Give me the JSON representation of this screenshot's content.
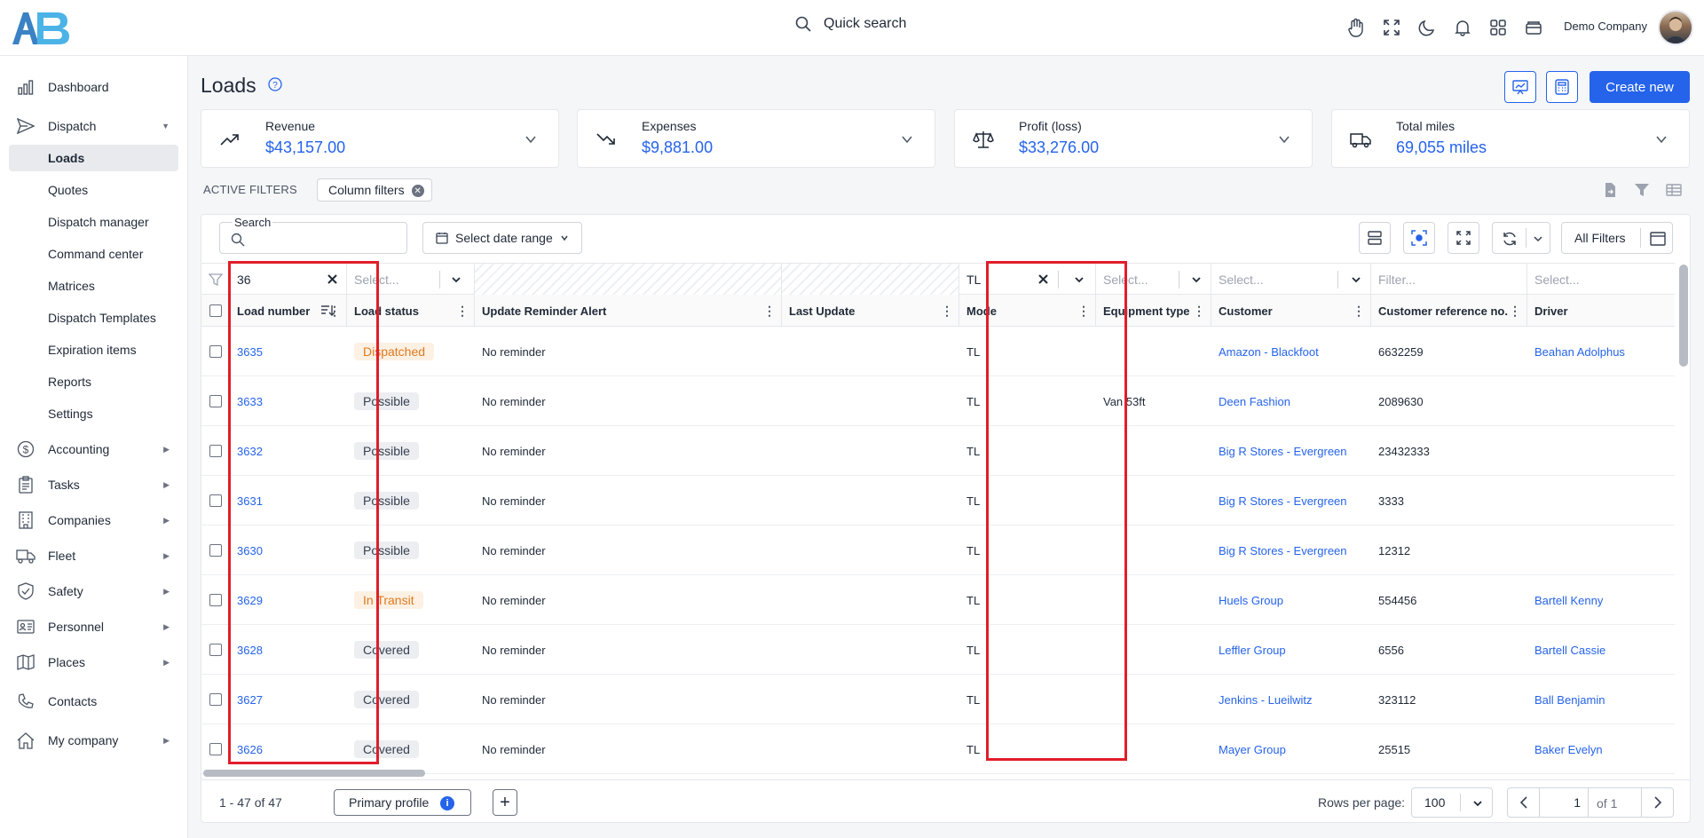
{
  "topbar": {
    "quick_search_label": "Quick search",
    "company_name": "Demo Company"
  },
  "sidebar": {
    "dashboard": "Dashboard",
    "dispatch": "Dispatch",
    "dispatch_items": [
      "Loads",
      "Quotes",
      "Dispatch manager",
      "Command center",
      "Matrices",
      "Dispatch Templates",
      "Expiration items",
      "Reports",
      "Settings"
    ],
    "accounting": "Accounting",
    "tasks": "Tasks",
    "companies": "Companies",
    "fleet": "Fleet",
    "safety": "Safety",
    "personnel": "Personnel",
    "places": "Places",
    "contacts": "Contacts",
    "my_company": "My company"
  },
  "page": {
    "title": "Loads",
    "create_label": "Create new"
  },
  "stats": [
    {
      "label": "Revenue",
      "value": "$43,157.00",
      "icon": "trend-up-icon"
    },
    {
      "label": "Expenses",
      "value": "$9,881.00",
      "icon": "trend-down-icon"
    },
    {
      "label": "Profit (loss)",
      "value": "$33,276.00",
      "icon": "scale-icon"
    },
    {
      "label": "Total miles",
      "value": "69,055 miles",
      "icon": "truck-icon"
    }
  ],
  "filters": {
    "active_label": "ACTIVE FILTERS",
    "chip_label": "Column filters"
  },
  "toolbar": {
    "search_label": "Search",
    "date_range_label": "Select date range",
    "all_filters_label": "All Filters"
  },
  "column_filters": {
    "load_number": "36",
    "load_status": "Select...",
    "mode": "TL",
    "equipment_type": "Select...",
    "customer": "Select...",
    "customer_ref": "Filter...",
    "driver": "Select..."
  },
  "columns": {
    "load_number": "Load number",
    "load_status": "Load status",
    "reminder": "Update Reminder Alert",
    "last_update": "Last Update",
    "mode": "Mode",
    "equipment_type": "Equipment type",
    "customer": "Customer",
    "customer_ref": "Customer reference no.",
    "driver": "Driver"
  },
  "rows": [
    {
      "load": "3635",
      "status": "Dispatched",
      "reminder": "No reminder",
      "mode": "TL",
      "equipment": "",
      "customer": "Amazon - Blackfoot",
      "ref": "6632259",
      "driver": "Beahan Adolphus"
    },
    {
      "load": "3633",
      "status": "Possible",
      "reminder": "No reminder",
      "mode": "TL",
      "equipment": "Van 53ft",
      "customer": "Deen Fashion",
      "ref": "2089630",
      "driver": ""
    },
    {
      "load": "3632",
      "status": "Possible",
      "reminder": "No reminder",
      "mode": "TL",
      "equipment": "",
      "customer": "Big R Stores - Evergreen",
      "ref": "23432333",
      "driver": ""
    },
    {
      "load": "3631",
      "status": "Possible",
      "reminder": "No reminder",
      "mode": "TL",
      "equipment": "",
      "customer": "Big R Stores - Evergreen",
      "ref": "3333",
      "driver": ""
    },
    {
      "load": "3630",
      "status": "Possible",
      "reminder": "No reminder",
      "mode": "TL",
      "equipment": "",
      "customer": "Big R Stores - Evergreen",
      "ref": "12312",
      "driver": ""
    },
    {
      "load": "3629",
      "status": "In Transit",
      "reminder": "No reminder",
      "mode": "TL",
      "equipment": "",
      "customer": "Huels Group",
      "ref": "554456",
      "driver": "Bartell Kenny"
    },
    {
      "load": "3628",
      "status": "Covered",
      "reminder": "No reminder",
      "mode": "TL",
      "equipment": "",
      "customer": "Leffler Group",
      "ref": "6556",
      "driver": "Bartell Cassie"
    },
    {
      "load": "3627",
      "status": "Covered",
      "reminder": "No reminder",
      "mode": "TL",
      "equipment": "",
      "customer": "Jenkins - Lueilwitz",
      "ref": "323112",
      "driver": "Ball Benjamin"
    },
    {
      "load": "3626",
      "status": "Covered",
      "reminder": "No reminder",
      "mode": "TL",
      "equipment": "",
      "customer": "Mayer Group",
      "ref": "25515",
      "driver": "Baker Evelyn"
    }
  ],
  "footer": {
    "range": "1 - 47 of 47",
    "profile_label": "Primary profile",
    "rows_per_page_label": "Rows per page:",
    "rows_per_page": "100",
    "page": "1",
    "of_pages": "of 1"
  },
  "colors": {
    "accent": "#2563eb",
    "highlight": "#e11d2a",
    "status_orange": "#dd7a1f"
  }
}
